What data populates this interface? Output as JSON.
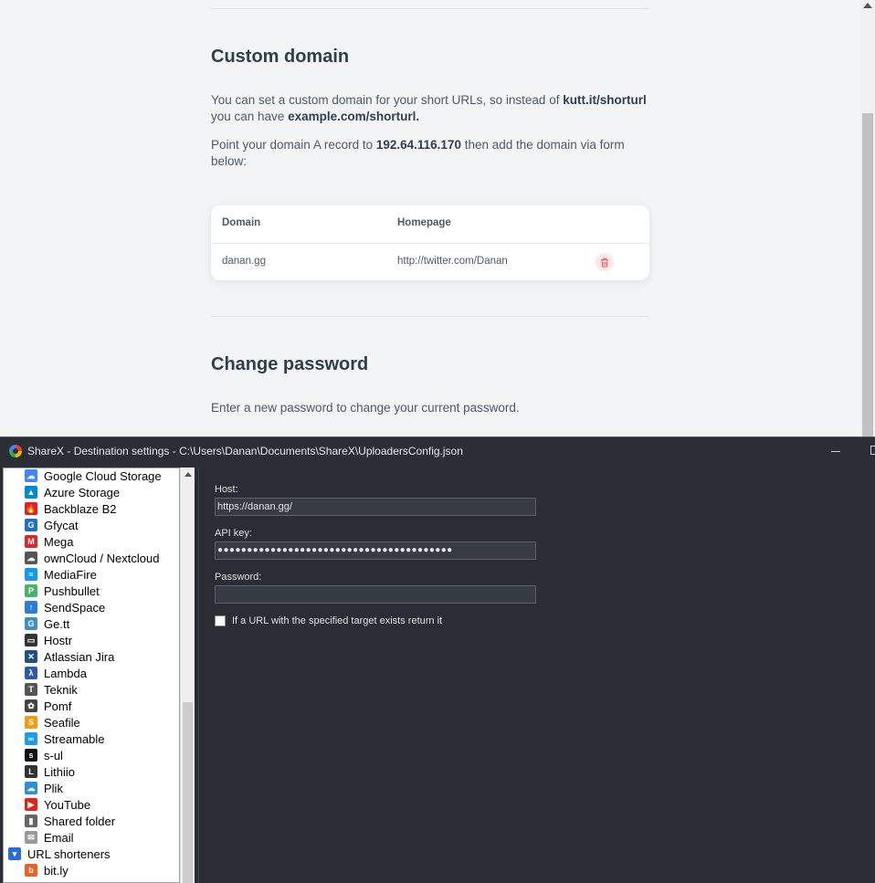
{
  "browser": {
    "custom_domain": {
      "title": "Custom domain",
      "intro_part1": "You can set a custom domain for your short URLs, so instead of ",
      "intro_bold1": "kutt.it/shorturl",
      "intro_part2": " you can have ",
      "intro_bold2": "example.com/shorturl.",
      "point_part1": "Point your domain A record to ",
      "point_ip": "192.64.116.170",
      "point_part2": " then add the domain via form below:",
      "table": {
        "headers": [
          "Domain",
          "Homepage"
        ],
        "rows": [
          {
            "domain": "danan.gg",
            "homepage": "http://twitter.com/Danan"
          }
        ]
      }
    },
    "change_password": {
      "title": "Change password",
      "description": "Enter a new password to change your current password."
    }
  },
  "sharex": {
    "title": "ShareX - Destination settings - C:\\Users\\Danan\\Documents\\ShareX\\UploadersConfig.json",
    "tree_items": [
      {
        "label": "Google Cloud Storage",
        "icon": "google-cloud-icon",
        "color": "#4285f4"
      },
      {
        "label": "Azure Storage",
        "icon": "azure-icon",
        "color": "#0089d6"
      },
      {
        "label": "Backblaze B2",
        "icon": "backblaze-icon",
        "color": "#e21e29"
      },
      {
        "label": "Gfycat",
        "icon": "gfycat-icon",
        "color": "#1d6fce"
      },
      {
        "label": "Mega",
        "icon": "mega-icon",
        "color": "#d9272e"
      },
      {
        "label": "ownCloud / Nextcloud",
        "icon": "owncloud-icon",
        "color": "#555555"
      },
      {
        "label": "MediaFire",
        "icon": "mediafire-icon",
        "color": "#1299f3"
      },
      {
        "label": "Pushbullet",
        "icon": "pushbullet-icon",
        "color": "#4ab367"
      },
      {
        "label": "SendSpace",
        "icon": "sendspace-icon",
        "color": "#2a7fd4"
      },
      {
        "label": "Ge.tt",
        "icon": "gett-icon",
        "color": "#3f8fc6"
      },
      {
        "label": "Hostr",
        "icon": "hostr-icon",
        "color": "#333333"
      },
      {
        "label": "Atlassian Jira",
        "icon": "jira-icon",
        "color": "#205081"
      },
      {
        "label": "Lambda",
        "icon": "lambda-icon",
        "color": "#2d5ba8"
      },
      {
        "label": "Teknik",
        "icon": "teknik-icon",
        "color": "#555555"
      },
      {
        "label": "Pomf",
        "icon": "pomf-icon",
        "color": "#444444"
      },
      {
        "label": "Seafile",
        "icon": "seafile-icon",
        "color": "#f39c12"
      },
      {
        "label": "Streamable",
        "icon": "streamable-icon",
        "color": "#1d9bf0"
      },
      {
        "label": "s-ul",
        "icon": "sul-icon",
        "color": "#111111"
      },
      {
        "label": "Lithiio",
        "icon": "lithiio-icon",
        "color": "#333333"
      },
      {
        "label": "Plik",
        "icon": "plik-icon",
        "color": "#2a8fd6"
      },
      {
        "label": "YouTube",
        "icon": "youtube-icon",
        "color": "#e62117"
      },
      {
        "label": "Shared folder",
        "icon": "shared-folder-icon",
        "color": "#666666"
      },
      {
        "label": "Email",
        "icon": "email-icon",
        "color": "#999999"
      },
      {
        "label": "URL shorteners",
        "icon": "url-shorteners-icon",
        "color": "#2b6cd8"
      },
      {
        "label": "bit.ly",
        "icon": "bitly-icon",
        "color": "#ee6123"
      }
    ],
    "form": {
      "host_label": "Host:",
      "host_value": "https://danan.gg/",
      "apikey_label": "API key:",
      "apikey_value": "●●●●●●●●●●●●●●●●●●●●●●●●●●●●●●●●●●●●●●●●",
      "password_label": "Password:",
      "password_value": "",
      "checkbox_label": "If a URL with the specified target exists return it"
    }
  }
}
